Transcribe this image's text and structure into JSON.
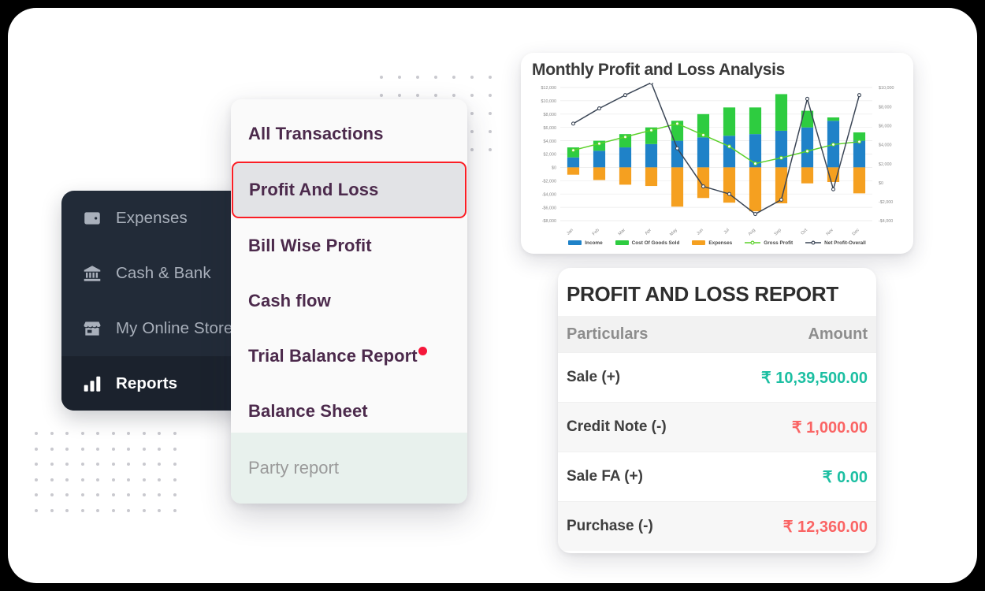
{
  "sidebar": {
    "items": [
      {
        "label": "Expenses",
        "icon": "wallet-icon",
        "active": false
      },
      {
        "label": "Cash & Bank",
        "icon": "bank-icon",
        "active": false
      },
      {
        "label": "My Online Store",
        "icon": "storefront-icon",
        "active": false
      },
      {
        "label": "Reports",
        "icon": "bar-chart-icon",
        "active": true
      }
    ]
  },
  "menu": {
    "items": [
      {
        "label": "All Transactions",
        "selected": false,
        "badge": false
      },
      {
        "label": "Profit And Loss",
        "selected": true,
        "badge": false
      },
      {
        "label": "Bill Wise Profit",
        "selected": false,
        "badge": false
      },
      {
        "label": "Cash flow",
        "selected": false,
        "badge": false
      },
      {
        "label": "Trial Balance Report",
        "selected": false,
        "badge": true
      },
      {
        "label": "Balance Sheet",
        "selected": false,
        "badge": false
      }
    ],
    "footer_label": "Party report",
    "highlight_color": "#fb1e25",
    "badge_color": "#f5173a"
  },
  "chart_data": {
    "type": "bar",
    "title": "Monthly Profit and Loss Analysis",
    "xlabel": "",
    "ylabel": "",
    "stacked": true,
    "grid": true,
    "legend_position": "bottom",
    "categories": [
      "Jan",
      "Feb",
      "Mar",
      "Apr",
      "May",
      "Jun",
      "Jul",
      "Aug",
      "Sep",
      "Oct",
      "Nov",
      "Dec"
    ],
    "ylim": [
      -8000,
      12000
    ],
    "yticks": [
      "$12,000",
      "$10,000",
      "$8,000",
      "$6,000",
      "$4,000",
      "$2,000",
      "$0",
      "-$2,000",
      "-$4,000",
      "-$6,000",
      "-$8,000"
    ],
    "y2lim": [
      -4000,
      10000
    ],
    "y2ticks": [
      "$10,000",
      "$8,000",
      "$6,000",
      "$4,000",
      "$2,000",
      "$0",
      "-$2,000",
      "-$4,000"
    ],
    "series": [
      {
        "name": "Income",
        "type": "bar",
        "color": "#1f82c8",
        "values": [
          1500,
          2500,
          3000,
          3500,
          4000,
          4500,
          4750,
          5000,
          5500,
          6000,
          7000,
          4000
        ]
      },
      {
        "name": "Cost Of Goods Sold",
        "type": "bar",
        "color": "#2ecc40",
        "values": [
          1500,
          1500,
          2000,
          2500,
          3000,
          3500,
          4250,
          4000,
          5500,
          2500,
          500,
          1250
        ]
      },
      {
        "name": "Expenses",
        "type": "bar",
        "color": "#f5a020",
        "values": [
          -1100,
          -1900,
          -2600,
          -2800,
          -5900,
          -4600,
          -5300,
          -6600,
          -5400,
          -2400,
          -2200,
          -3900
        ]
      },
      {
        "name": "Gross Profit",
        "type": "line",
        "color": "#5bd12a",
        "values": [
          3400,
          4100,
          4800,
          5500,
          6200,
          5000,
          3800,
          2000,
          2600,
          3300,
          4000,
          4300
        ]
      },
      {
        "name": "Net Profit-Overall",
        "type": "line",
        "color": "#3b4656",
        "values": [
          6200,
          7800,
          9200,
          10500,
          3600,
          -400,
          -1200,
          -3300,
          -1800,
          8800,
          -700,
          9200
        ]
      }
    ]
  },
  "report": {
    "title": "PROFIT AND LOSS REPORT",
    "columns": [
      "Particulars",
      "Amount"
    ],
    "rows": [
      {
        "label": "Sale (+)",
        "amount": "₹ 10,39,500.00",
        "sign": "pos"
      },
      {
        "label": "Credit Note (-)",
        "amount": "₹ 1,000.00",
        "sign": "neg"
      },
      {
        "label": "Sale FA (+)",
        "amount": "₹ 0.00",
        "sign": "pos"
      },
      {
        "label": "Purchase (-)",
        "amount": "₹ 12,360.00",
        "sign": "neg"
      }
    ],
    "positive_color": "#1cbfa2",
    "negative_color": "#fa6464"
  }
}
